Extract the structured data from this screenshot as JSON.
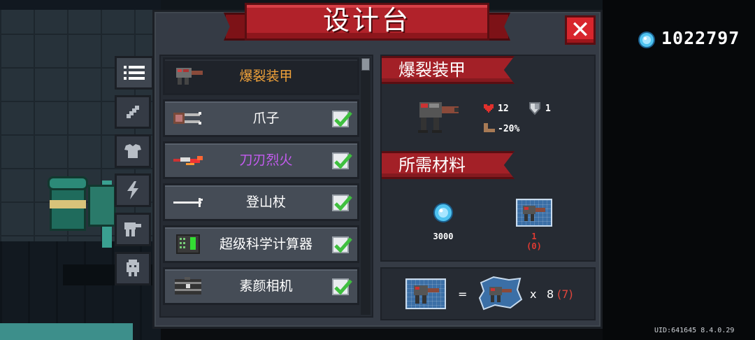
{
  "header": {
    "title": "设计台",
    "close": "✕"
  },
  "currency": {
    "amount": "1022797",
    "icon": "gem-icon"
  },
  "uid": "UID:641645 8.4.0.29",
  "tabs": [
    {
      "name": "list",
      "icon": "list-icon",
      "active": true
    },
    {
      "name": "weapon",
      "icon": "sword-icon"
    },
    {
      "name": "armor",
      "icon": "armor-icon"
    },
    {
      "name": "skill",
      "icon": "lightning-icon"
    },
    {
      "name": "mech",
      "icon": "mech-icon"
    },
    {
      "name": "pet",
      "icon": "creature-icon"
    }
  ],
  "items": [
    {
      "label": "爆裂装甲",
      "color": "orange",
      "selected": true,
      "checked": false
    },
    {
      "label": "爪子",
      "color": "white",
      "checked": true
    },
    {
      "label": "刀刃烈火",
      "color": "purple",
      "checked": true
    },
    {
      "label": "登山杖",
      "color": "white",
      "checked": true
    },
    {
      "label": "超级科学计算器",
      "color": "white",
      "checked": true
    },
    {
      "label": "素颜相机",
      "color": "white",
      "checked": true
    }
  ],
  "detail": {
    "name": "爆裂装甲",
    "hp": "12",
    "armor": "1",
    "speed": "-20%"
  },
  "materials": {
    "header": "所需材料",
    "gem_cost": "3000",
    "blueprint_count": "1",
    "blueprint_owned": "(0)"
  },
  "recipe": {
    "equals": "=",
    "times": "x",
    "need": "8",
    "have": "(7)"
  },
  "colors": {
    "accent_red": "#b1222a",
    "orange": "#f0a23a",
    "purple": "#c45cf0",
    "check_green": "#3fbf3f"
  }
}
